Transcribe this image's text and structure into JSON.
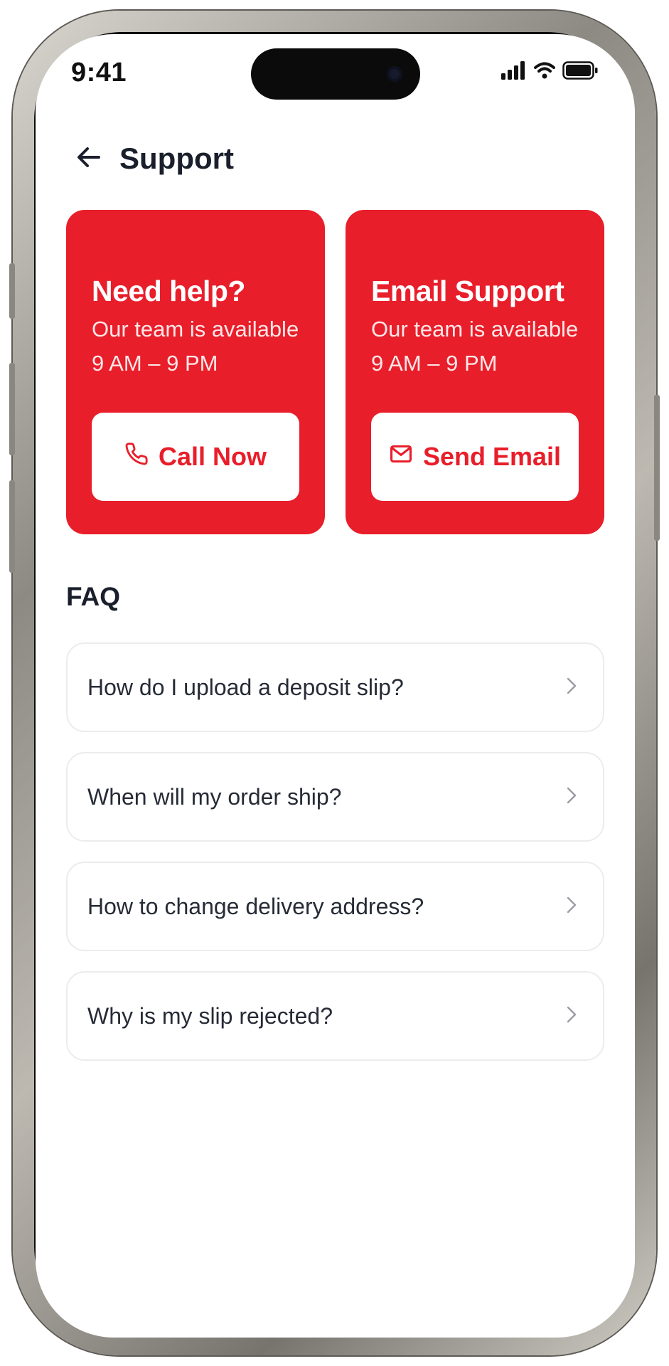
{
  "status_bar": {
    "time": "9:41",
    "icons": [
      "cellular-signal-icon",
      "wifi-icon",
      "battery-icon"
    ]
  },
  "header": {
    "back_icon": "arrow-left-icon",
    "title": "Support"
  },
  "support_cards": [
    {
      "title": "Need help?",
      "description": "Our team is available 9 AM – 9 PM",
      "button_label": "Call Now",
      "button_icon": "phone-icon"
    },
    {
      "title": "Email Support",
      "description": "Our team is available 9 AM – 9 PM",
      "button_label": "Send Email",
      "button_icon": "mail-icon"
    }
  ],
  "faq": {
    "heading": "FAQ",
    "items": [
      {
        "question": "How do I upload a deposit slip?",
        "icon": "chevron-right-icon"
      },
      {
        "question": "When will my order ship?",
        "icon": "chevron-right-icon"
      },
      {
        "question": "How to change delivery address?",
        "icon": "chevron-right-icon"
      },
      {
        "question": "Why is my slip rejected?",
        "icon": "chevron-right-icon"
      }
    ]
  },
  "colors": {
    "accent": "#e81e2a",
    "title_text": "#1a1f2c",
    "body_text": "#262b36",
    "card_border": "#ececec"
  }
}
